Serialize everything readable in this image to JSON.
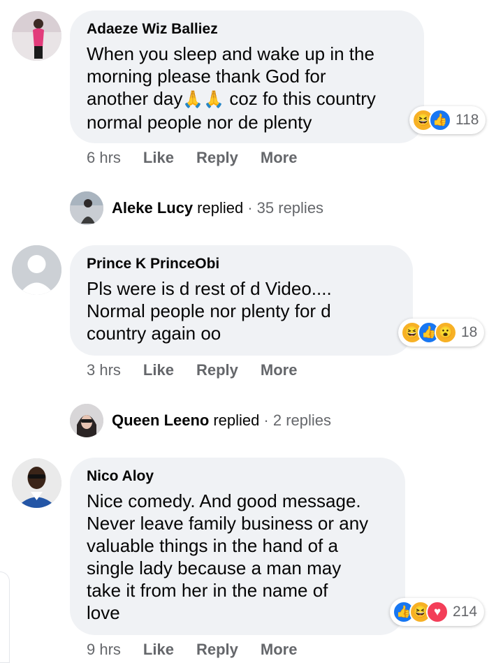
{
  "comments": [
    {
      "author": "Adaeze Wiz Balliez",
      "lines": [
        "When you sleep and wake up in the",
        "morning please thank God for",
        "another day",
        "coz fo this country",
        "normal people nor de plenty"
      ],
      "emoji": "🙏🙏",
      "reaction_count": "118",
      "reactions": [
        "haha",
        "like"
      ],
      "time": "6 hrs",
      "like": "Like",
      "reply": "Reply",
      "more": "More",
      "reply_summary": {
        "name": "Aleke Lucy",
        "word": "replied",
        "count": "· 35 replies"
      }
    },
    {
      "author": "Prince K PrinceObi",
      "lines": [
        "Pls were is d rest of d Video....",
        "Normal people nor plenty for d",
        "country again oo"
      ],
      "reaction_count": "18",
      "reactions": [
        "haha",
        "like",
        "wow"
      ],
      "time": "3 hrs",
      "like": "Like",
      "reply": "Reply",
      "more": "More",
      "reply_summary": {
        "name": "Queen Leeno",
        "word": "replied",
        "count": "· 2 replies"
      }
    },
    {
      "author": "Nico Aloy",
      "lines": [
        "Nice comedy. And good message.",
        "Never leave family business or any",
        "valuable things in the hand of a",
        "single lady because a man may",
        "take it from her in the name of",
        "love"
      ],
      "reaction_count": "214",
      "reactions": [
        "like",
        "haha",
        "love"
      ],
      "time": "9 hrs",
      "like": "Like",
      "reply": "Reply",
      "more": "More"
    }
  ],
  "colors": {
    "bubble": "#f0f2f5",
    "secondary_text": "#65676b",
    "like_blue": "#1877f2",
    "haha_yellow": "#f7b125",
    "love_red": "#f33e58"
  }
}
